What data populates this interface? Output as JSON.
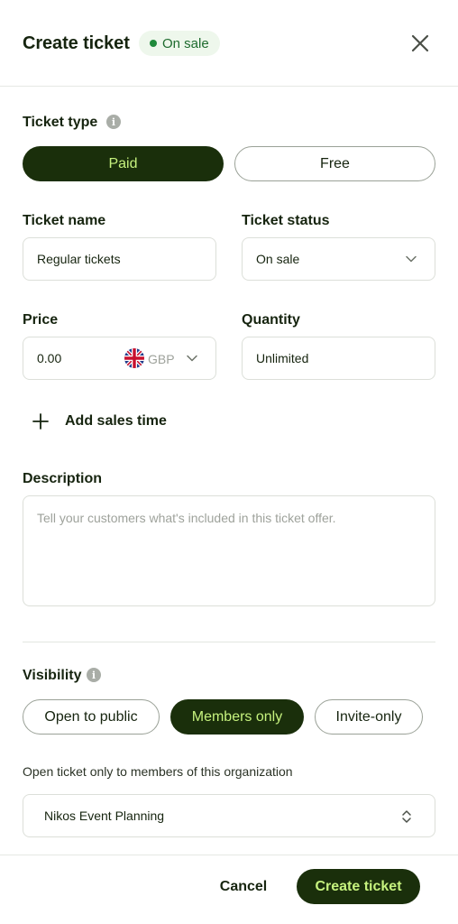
{
  "header": {
    "title": "Create ticket",
    "status_badge": "On sale",
    "close_icon": "close-icon"
  },
  "ticket_type": {
    "label": "Ticket type",
    "options": [
      "Paid",
      "Free"
    ],
    "selected": "Paid"
  },
  "ticket_name": {
    "label": "Ticket name",
    "value": "Regular tickets"
  },
  "ticket_status": {
    "label": "Ticket status",
    "value": "On sale"
  },
  "price": {
    "label": "Price",
    "value": "0.00",
    "currency": "GBP",
    "flag_icon": "uk-flag-icon"
  },
  "quantity": {
    "label": "Quantity",
    "value": "Unlimited"
  },
  "add_sales_time": {
    "label": "Add sales time",
    "icon": "plus-icon"
  },
  "description": {
    "label": "Description",
    "placeholder": "Tell your customers what's included in this ticket offer."
  },
  "visibility": {
    "label": "Visibility",
    "options": [
      "Open to public",
      "Members only",
      "Invite-only"
    ],
    "selected": "Members only",
    "helper": "Open ticket only to members of this organization",
    "organization": "Nikos Event Planning"
  },
  "footer": {
    "cancel_label": "Cancel",
    "create_label": "Create ticket"
  },
  "colors": {
    "primary_dark": "#1a2f0b",
    "primary_accent": "#c6f27e",
    "badge_bg": "#eef7ec",
    "badge_text": "#1e6b2e"
  }
}
